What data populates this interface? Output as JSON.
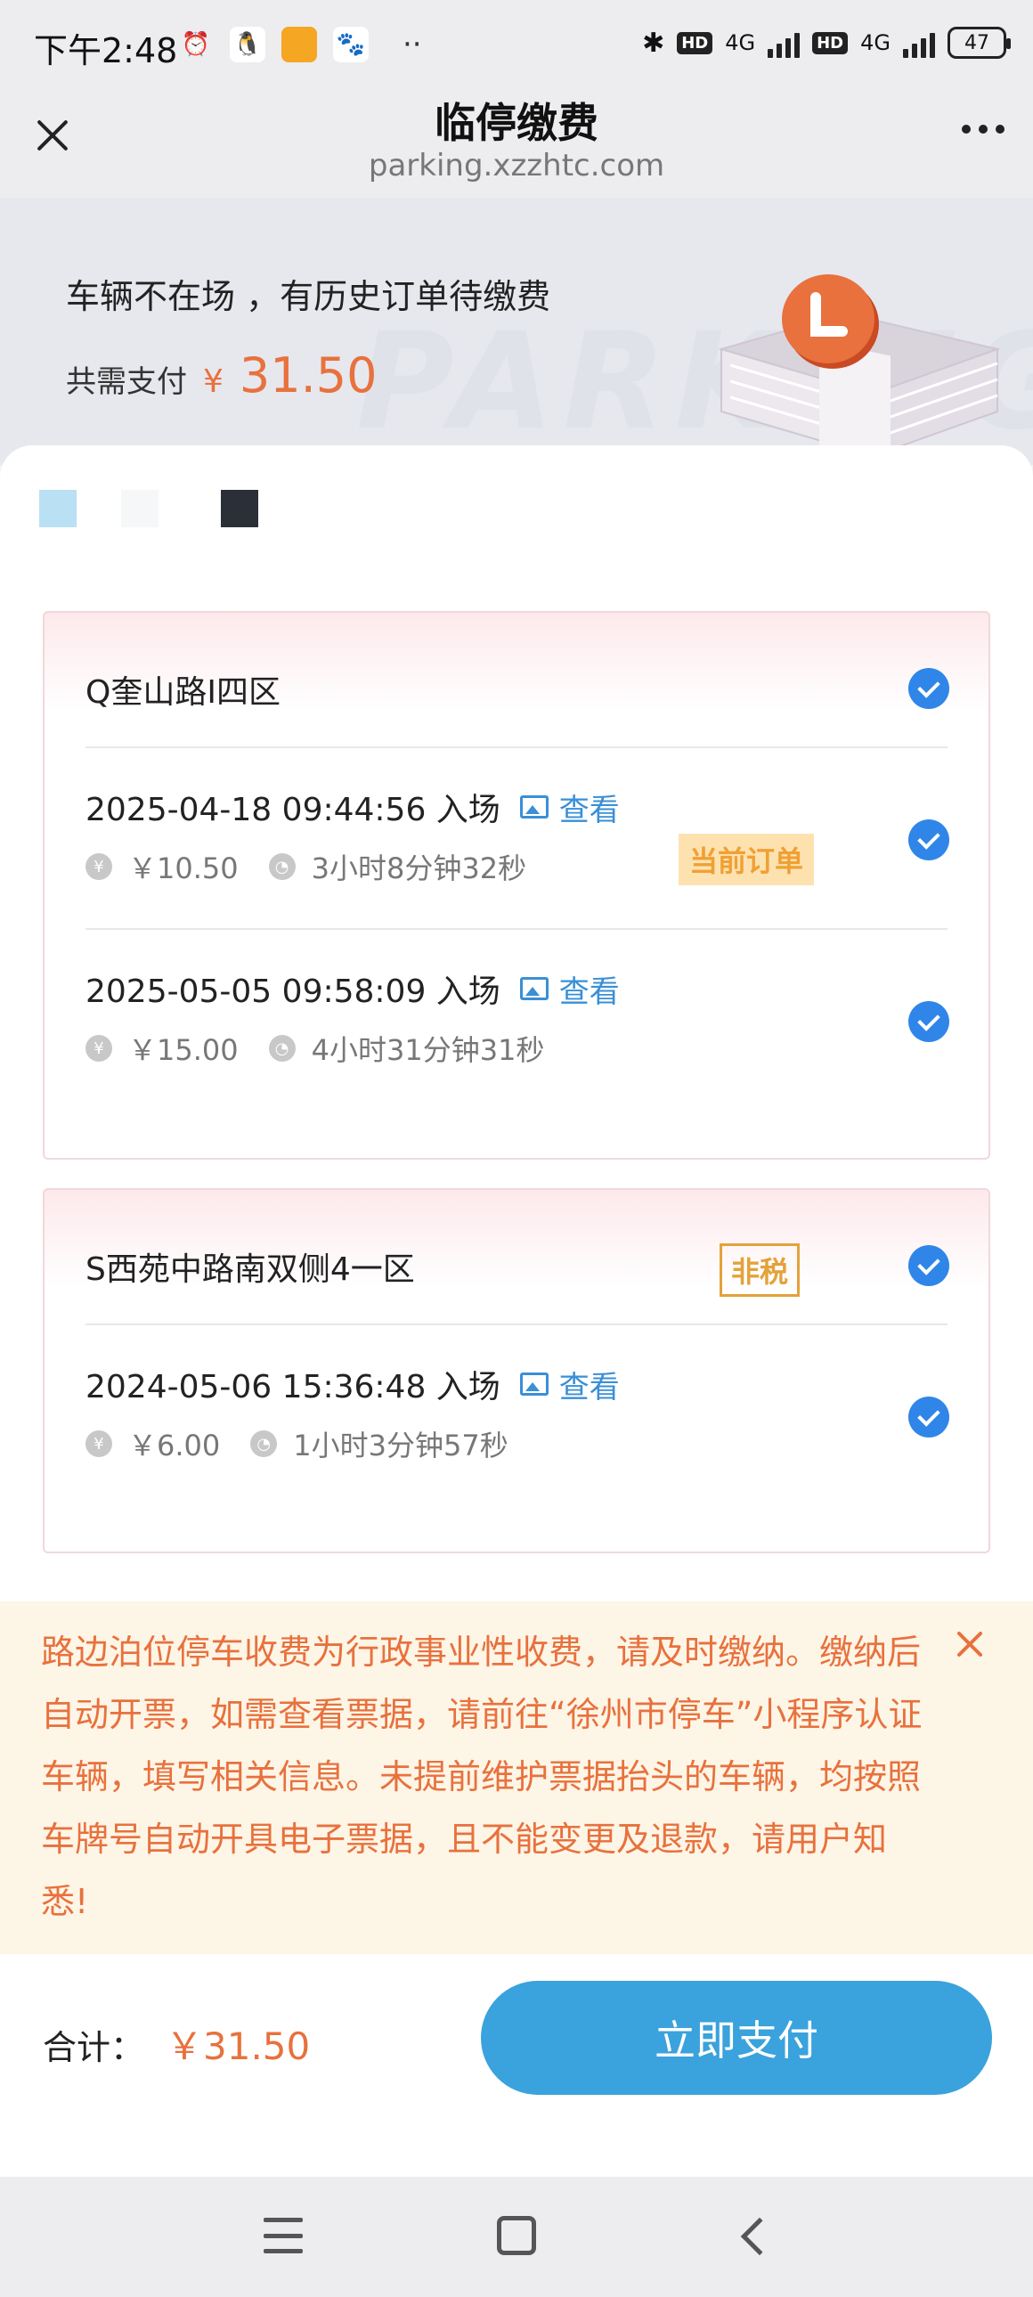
{
  "status_bar": {
    "time": "下午2:48",
    "network_1": "4G",
    "network_2": "4G",
    "hd_label": "HD",
    "battery": "47"
  },
  "title_bar": {
    "title": "临停缴费",
    "url": "parking.xzzhtc.com"
  },
  "banner": {
    "status_text": "车辆不在场 ，有历史订单待缴费",
    "total_label": "共需支付",
    "currency": "¥",
    "total_amount": "31.50",
    "watermark": "PARKING"
  },
  "plate_swatches": [
    "#b9e0f3",
    "#f6f7f9",
    "#2b2f38"
  ],
  "lots": [
    {
      "name": "Q奎山路I四区",
      "tag": "",
      "checked": true,
      "orders": [
        {
          "entry": "2025-04-18 09:44:56 入场",
          "view_label": "查看",
          "amount": "￥10.50",
          "duration": "3小时8分钟32秒",
          "current_tag": "当前订单",
          "checked": true
        },
        {
          "entry": "2025-05-05 09:58:09 入场",
          "view_label": "查看",
          "amount": "￥15.00",
          "duration": "4小时31分钟31秒",
          "current_tag": "",
          "checked": true
        }
      ]
    },
    {
      "name": "S西苑中路南双侧4一区",
      "tag": "非税",
      "checked": true,
      "orders": [
        {
          "entry": "2024-05-06 15:36:48 入场",
          "view_label": "查看",
          "amount": "￥6.00",
          "duration": "1小时3分钟57秒",
          "current_tag": "",
          "checked": true
        }
      ]
    }
  ],
  "notice": {
    "text": "路边泊位停车收费为行政事业性收费，请及时缴纳。缴纳后自动开票，如需查看票据，请前往“徐州市停车”小程序认证车辆，填写相关信息。未提前维护票据抬头的车辆，均按照车牌号自动开具电子票据，且不能变更及退款，请用户知悉!"
  },
  "footer": {
    "sum_label": "合计：",
    "sum_amount": "￥31.50",
    "pay_button": "立即支付"
  },
  "colors": {
    "accent_orange": "#e8713d",
    "check_blue": "#2f86e8",
    "pay_blue": "#3aa2dc",
    "tag_gold": "#e3a23a"
  }
}
